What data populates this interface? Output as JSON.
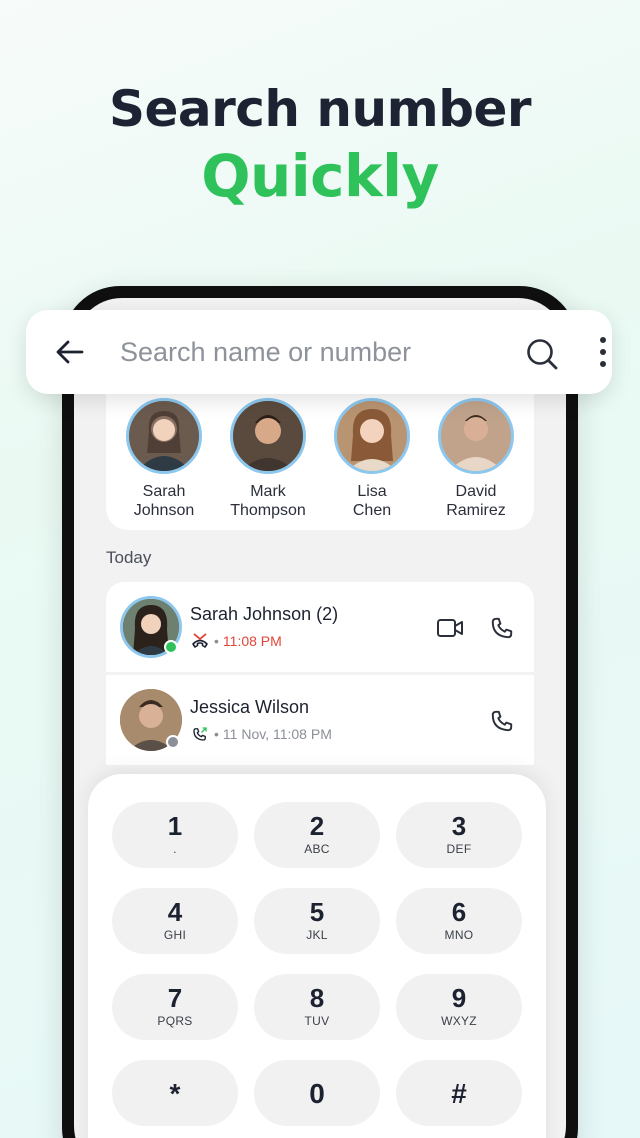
{
  "headline": {
    "line1": "Search number",
    "line2": "Quickly"
  },
  "search": {
    "placeholder": "Search name or number"
  },
  "favorites": [
    {
      "first": "Sarah",
      "last": "Johnson",
      "color": "#6b5a4e"
    },
    {
      "first": "Mark",
      "last": "Thompson",
      "color": "#8a6a52"
    },
    {
      "first": "Lisa",
      "last": "Chen",
      "color": "#b99472"
    },
    {
      "first": "David",
      "last": "Ramirez",
      "color": "#c1a38c"
    }
  ],
  "recents": {
    "section_title": "Today",
    "items": [
      {
        "name": "Sarah Johnson (2)",
        "time": "11:08 PM",
        "type": "missed",
        "status": "online"
      },
      {
        "name": "Jessica Wilson",
        "time": "11 Nov, 11:08 PM",
        "type": "outgoing",
        "status": "offline"
      }
    ]
  },
  "dialpad": {
    "keys": [
      {
        "digit": "1",
        "letters": "."
      },
      {
        "digit": "2",
        "letters": "ABC"
      },
      {
        "digit": "3",
        "letters": "DEF"
      },
      {
        "digit": "4",
        "letters": "GHI"
      },
      {
        "digit": "5",
        "letters": "JKL"
      },
      {
        "digit": "6",
        "letters": "MNO"
      },
      {
        "digit": "7",
        "letters": "PQRS"
      },
      {
        "digit": "8",
        "letters": "TUV"
      },
      {
        "digit": "9",
        "letters": "WXYZ"
      },
      {
        "digit": "*",
        "letters": ""
      },
      {
        "digit": "0",
        "letters": ""
      },
      {
        "digit": "#",
        "letters": ""
      }
    ]
  },
  "colors": {
    "accent": "#2fc25b",
    "missed": "#e2463b",
    "ring": "#8cc7ee"
  }
}
